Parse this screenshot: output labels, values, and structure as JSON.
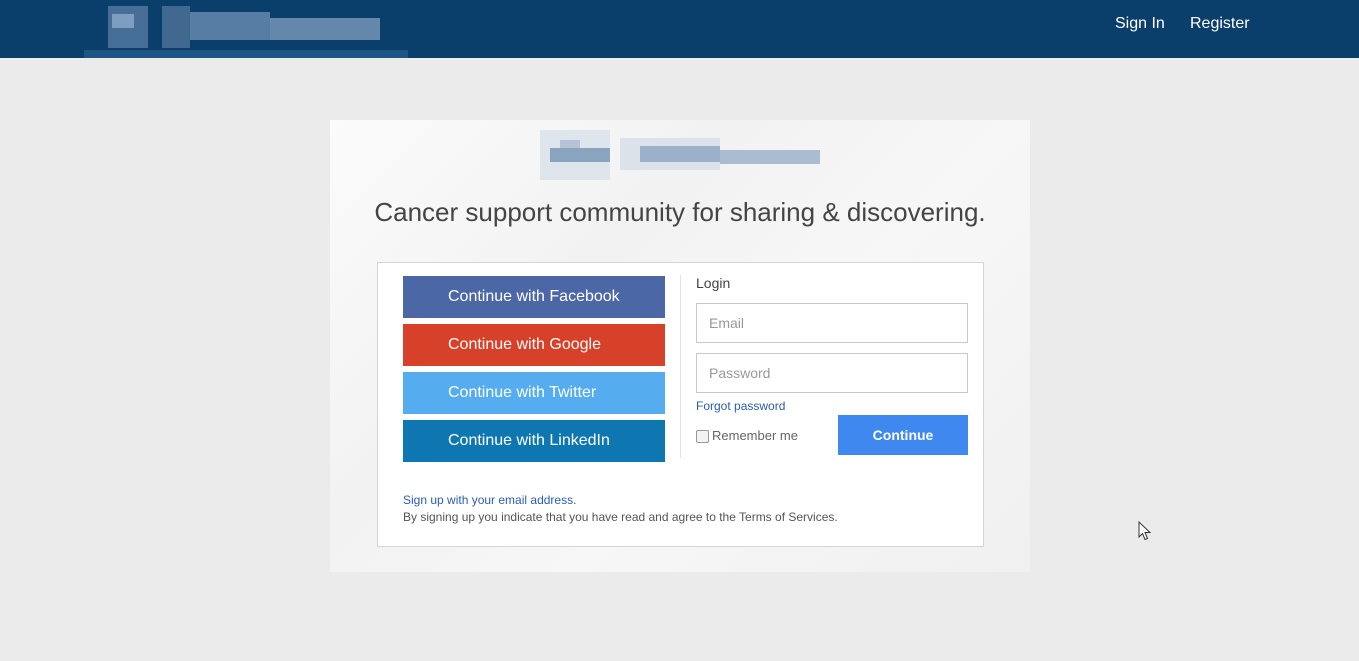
{
  "header": {
    "nav": {
      "sign_in": "Sign In",
      "register": "Register"
    }
  },
  "main": {
    "tagline": "Cancer support community for sharing & discovering.",
    "social_buttons": {
      "facebook": "Continue with Facebook",
      "google": "Continue with Google",
      "twitter": "Continue with Twitter",
      "linkedin": "Continue with LinkedIn"
    },
    "login": {
      "heading": "Login",
      "email_placeholder": "Email",
      "password_placeholder": "Password",
      "forgot_password": "Forgot password",
      "remember_me": "Remember me",
      "remember_checked": false,
      "continue_label": "Continue"
    },
    "signup_link": "Sign up with your email address.",
    "terms_text": "By signing up you indicate that you have read and agree to the Terms of Services."
  },
  "colors": {
    "header_bg": "#0b3f6b",
    "facebook": "#4b67a6",
    "google": "#d74129",
    "twitter": "#55acee",
    "linkedin": "#0e77b2",
    "primary_button": "#3e88f0",
    "link": "#2a5db0"
  },
  "icons": {
    "logo": "pixelated-logo",
    "cursor": "mouse-pointer-icon"
  }
}
